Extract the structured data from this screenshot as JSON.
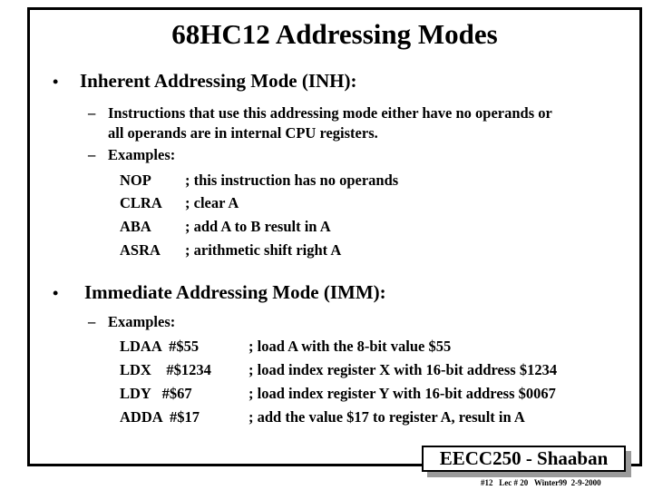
{
  "slide": {
    "title": "68HC12 Addressing Modes",
    "sections": [
      {
        "bullet": "•",
        "heading": "Inherent Addressing Mode (INH):",
        "items": [
          {
            "dash": "–",
            "text_line1": "Instructions that use this addressing mode either have no operands or",
            "text_line2": "all operands are in internal CPU registers."
          },
          {
            "dash": "–",
            "text": "Examples:"
          }
        ],
        "examples": [
          {
            "instr": "NOP",
            "comment": "; this instruction has no operands"
          },
          {
            "instr": "CLRA",
            "comment": "; clear A"
          },
          {
            "instr": "ABA",
            "comment": "; add A to B result in A"
          },
          {
            "instr": "ASRA",
            "comment": "; arithmetic shift right A"
          }
        ]
      },
      {
        "bullet": "•",
        "heading": "Immediate Addressing Mode (IMM):",
        "items": [
          {
            "dash": "–",
            "text": "Examples:"
          }
        ],
        "examples": [
          {
            "instr": "LDAA  #$55",
            "comment": "; load A with the 8-bit value $55"
          },
          {
            "instr": "LDX    #$1234",
            "comment": "; load index register X with 16-bit address $1234"
          },
          {
            "instr": "LDY   #$67",
            "comment": "; load index register Y with 16-bit address $0067"
          },
          {
            "instr": "ADDA  #$17",
            "comment": "; add the value $17 to register A, result in A"
          }
        ]
      }
    ],
    "footer": {
      "label": "EECC250 - Shaaban",
      "sub": "#12   Lec # 20   Winter99  2-9-2000"
    }
  }
}
